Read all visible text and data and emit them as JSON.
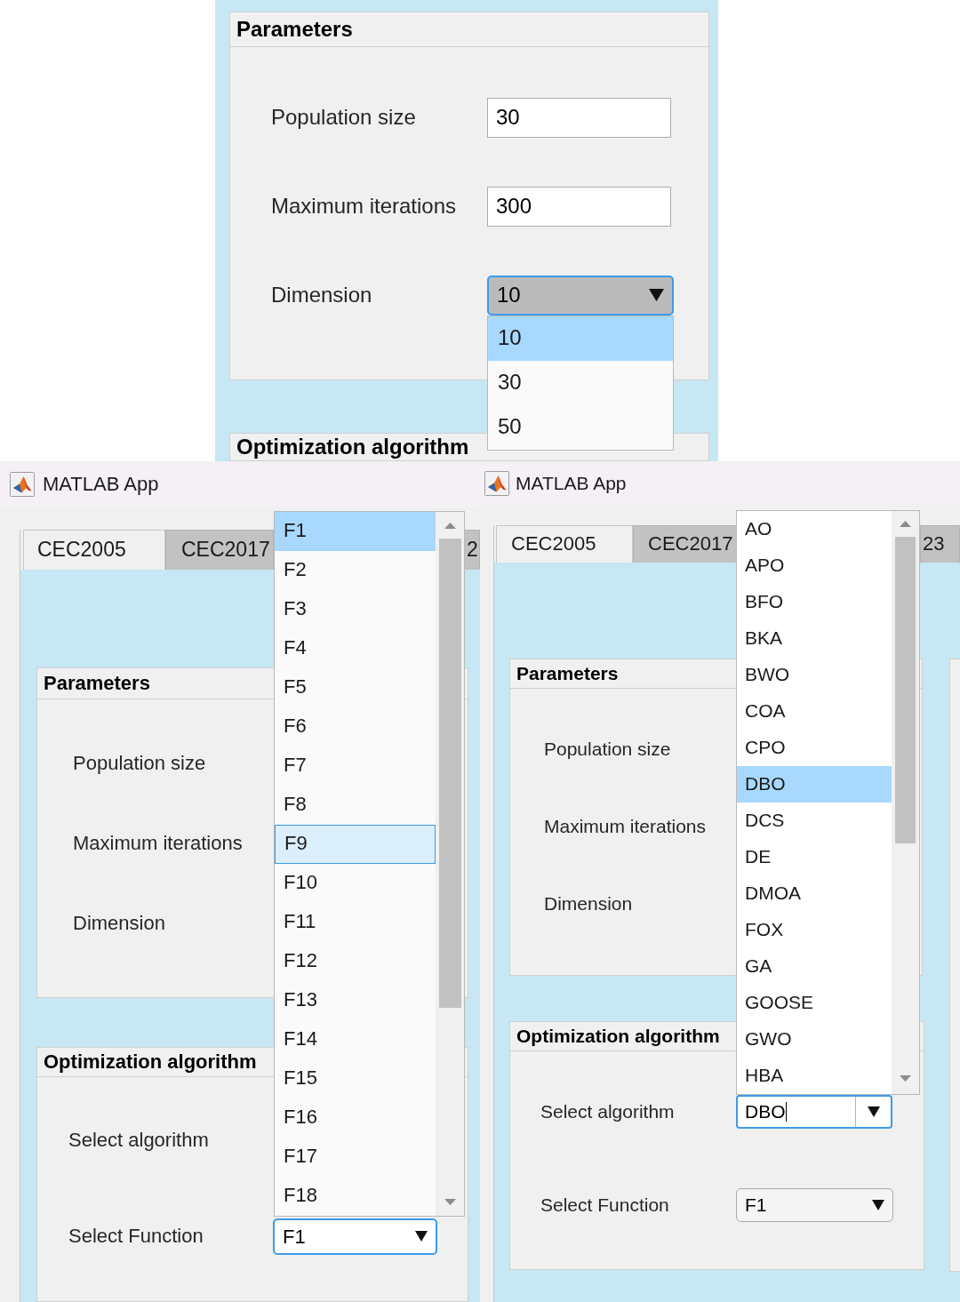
{
  "top_view": {
    "parameters_panel": {
      "title": "Parameters",
      "fields": [
        {
          "kind": "text",
          "label": "Population size",
          "value": "30"
        },
        {
          "kind": "text",
          "label": "Maximum iterations",
          "value": "300"
        },
        {
          "kind": "dropdown",
          "label": "Dimension",
          "value": "10",
          "pressed": true,
          "expanded": true,
          "options": [
            {
              "label": "10",
              "selected": true,
              "hovered": false
            },
            {
              "label": "30",
              "selected": false,
              "hovered": false
            },
            {
              "label": "50",
              "selected": false,
              "hovered": false
            }
          ]
        }
      ]
    },
    "algorithm_panel": {
      "title": "Optimization algorithm"
    }
  },
  "windows": [
    {
      "title": "MATLAB App",
      "tabs": [
        {
          "label": "CEC2005",
          "selected": true
        },
        {
          "label": "CEC2017",
          "selected": false
        },
        {
          "label": "2",
          "selected": false
        }
      ],
      "parameters_panel": {
        "title": "Parameters",
        "fields": [
          {
            "label": "Population size"
          },
          {
            "label": "Maximum iterations"
          },
          {
            "label": "Dimension"
          }
        ]
      },
      "algorithm_panel": {
        "title": "Optimization algorithm",
        "fields": [
          {
            "label": "Select algorithm"
          },
          {
            "kind": "dropdown",
            "label": "Select Function",
            "value": "F1",
            "expanded": true,
            "options": [
              {
                "label": "F1",
                "selected": true,
                "hovered": false
              },
              {
                "label": "F2",
                "selected": false,
                "hovered": false
              },
              {
                "label": "F3",
                "selected": false,
                "hovered": false
              },
              {
                "label": "F4",
                "selected": false,
                "hovered": false
              },
              {
                "label": "F5",
                "selected": false,
                "hovered": false
              },
              {
                "label": "F6",
                "selected": false,
                "hovered": false
              },
              {
                "label": "F7",
                "selected": false,
                "hovered": false
              },
              {
                "label": "F8",
                "selected": false,
                "hovered": false
              },
              {
                "label": "F9",
                "selected": false,
                "hovered": true
              },
              {
                "label": "F10",
                "selected": false,
                "hovered": false
              },
              {
                "label": "F11",
                "selected": false,
                "hovered": false
              },
              {
                "label": "F12",
                "selected": false,
                "hovered": false
              },
              {
                "label": "F13",
                "selected": false,
                "hovered": false
              },
              {
                "label": "F14",
                "selected": false,
                "hovered": false
              },
              {
                "label": "F15",
                "selected": false,
                "hovered": false
              },
              {
                "label": "F16",
                "selected": false,
                "hovered": false
              },
              {
                "label": "F17",
                "selected": false,
                "hovered": false
              },
              {
                "label": "F18",
                "selected": false,
                "hovered": false
              }
            ]
          }
        ]
      }
    },
    {
      "title": "MATLAB App",
      "tabs": [
        {
          "label": "CEC2005",
          "selected": true
        },
        {
          "label": "CEC2017",
          "selected": false
        },
        {
          "label": "23",
          "selected": false
        }
      ],
      "parameters_panel": {
        "title": "Parameters",
        "fields": [
          {
            "label": "Population size"
          },
          {
            "label": "Maximum iterations"
          },
          {
            "label": "Dimension"
          }
        ]
      },
      "algorithm_panel": {
        "title": "Optimization algorithm",
        "fields": [
          {
            "kind": "editable",
            "label": "Select algorithm",
            "value": "DBO",
            "expanded": true,
            "options": [
              {
                "label": "AO",
                "selected": false,
                "hovered": false
              },
              {
                "label": "APO",
                "selected": false,
                "hovered": false
              },
              {
                "label": "BFO",
                "selected": false,
                "hovered": false
              },
              {
                "label": "BKA",
                "selected": false,
                "hovered": false
              },
              {
                "label": "BWO",
                "selected": false,
                "hovered": false
              },
              {
                "label": "COA",
                "selected": false,
                "hovered": false
              },
              {
                "label": "CPO",
                "selected": false,
                "hovered": false
              },
              {
                "label": "DBO",
                "selected": true,
                "hovered": false
              },
              {
                "label": "DCS",
                "selected": false,
                "hovered": false
              },
              {
                "label": "DE",
                "selected": false,
                "hovered": false
              },
              {
                "label": "DMOA",
                "selected": false,
                "hovered": false
              },
              {
                "label": "FOX",
                "selected": false,
                "hovered": false
              },
              {
                "label": "GA",
                "selected": false,
                "hovered": false
              },
              {
                "label": "GOOSE",
                "selected": false,
                "hovered": false
              },
              {
                "label": "GWO",
                "selected": false,
                "hovered": false
              },
              {
                "label": "HBA",
                "selected": false,
                "hovered": false
              }
            ]
          },
          {
            "kind": "dropdown",
            "label": "Select Function",
            "value": "F1",
            "expanded": false
          }
        ]
      }
    }
  ]
}
